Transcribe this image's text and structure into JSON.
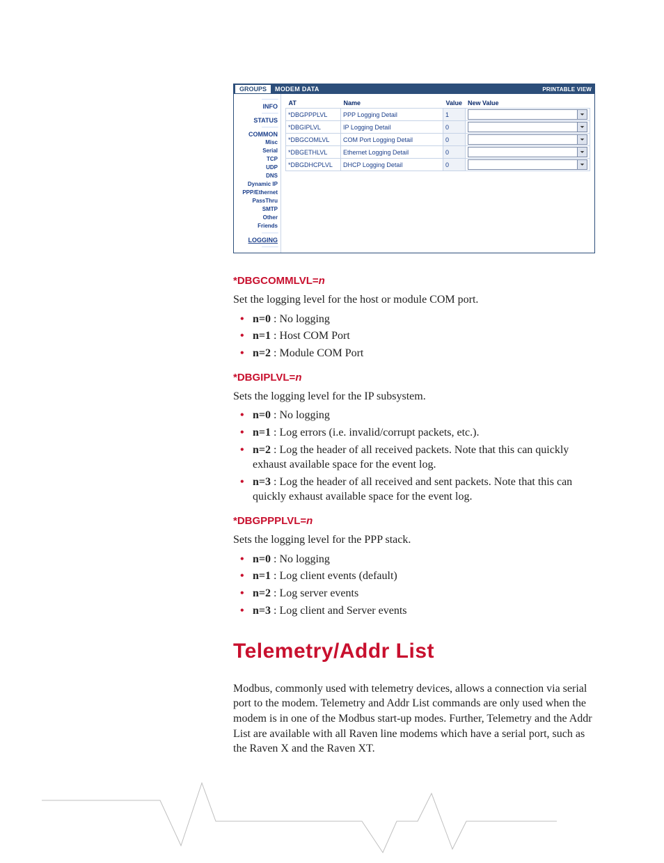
{
  "screenshot": {
    "tab_groups": "GROUPS",
    "header_modem_data": "MODEM DATA",
    "printable_view": "PRINTABLE VIEW",
    "sidebar": {
      "info": "INFO",
      "status": "STATUS",
      "common": "COMMON",
      "misc": "Misc",
      "serial": "Serial",
      "tcp": "TCP",
      "udp": "UDP",
      "dns": "DNS",
      "dynamic_ip": "Dynamic IP",
      "ppp_ethernet": "PPP/Ethernet",
      "passthru": "PassThru",
      "smtp": "SMTP",
      "other": "Other",
      "friends": "Friends",
      "logging": "LOGGING"
    },
    "columns": {
      "at": "AT",
      "name": "Name",
      "value": "Value",
      "new_value": "New Value"
    },
    "rows": [
      {
        "at": "*DBGPPPLVL",
        "name": "PPP Logging Detail",
        "value": "1",
        "new_value": ""
      },
      {
        "at": "*DBGIPLVL",
        "name": "IP Logging Detail",
        "value": "0",
        "new_value": ""
      },
      {
        "at": "*DBGCOMLVL",
        "name": "COM Port Logging Detail",
        "value": "0",
        "new_value": ""
      },
      {
        "at": "*DBGETHLVL",
        "name": "Ethernet Logging Detail",
        "value": "0",
        "new_value": ""
      },
      {
        "at": "*DBGDHCPLVL",
        "name": "DHCP Logging Detail",
        "value": "0",
        "new_value": ""
      }
    ]
  },
  "doc": {
    "cmd1": {
      "head": "*DBGCOMMLVL=",
      "n": "n",
      "desc": "Set the logging level for the host or module COM port.",
      "items": [
        {
          "b": "n=0",
          "rest": " : No logging"
        },
        {
          "b": "n=1",
          "rest": " : Host COM Port"
        },
        {
          "b": "n=2",
          "rest": " : Module COM Port"
        }
      ]
    },
    "cmd2": {
      "head": "*DBGIPLVL=",
      "n": "n",
      "desc": "Sets the logging level for the IP subsystem.",
      "items": [
        {
          "b": "n=0",
          "rest": " : No logging"
        },
        {
          "b": "n=1",
          "rest": " : Log errors (i.e. invalid/corrupt packets, etc.)."
        },
        {
          "b": "n=2",
          "rest": " : Log the header of all received packets. Note that this can quickly exhaust available space for the event log."
        },
        {
          "b": "n=3",
          "rest": " : Log the header of all received and sent packets. Note that this can quickly exhaust available space for the event log."
        }
      ]
    },
    "cmd3": {
      "head": "*DBGPPPLVL=",
      "n": "n",
      "desc": "Sets the logging level for the PPP stack.",
      "items": [
        {
          "b": "n=0",
          "rest": " : No logging"
        },
        {
          "b": "n=1",
          "rest": " : Log client events (default)"
        },
        {
          "b": "n=2",
          "rest": " : Log server events"
        },
        {
          "b": "n=3",
          "rest": " : Log client and Server events"
        }
      ]
    },
    "section_title": "Telemetry/Addr List",
    "section_body": "Modbus, commonly used with telemetry devices, allows a connection via serial port to the modem. Telemetry and Addr List commands are only used when the modem is in one of the Modbus start-up modes. Further, Telemetry and the Addr List are available with all Raven line modems which have a serial port, such as the Raven X and the Raven XT."
  }
}
